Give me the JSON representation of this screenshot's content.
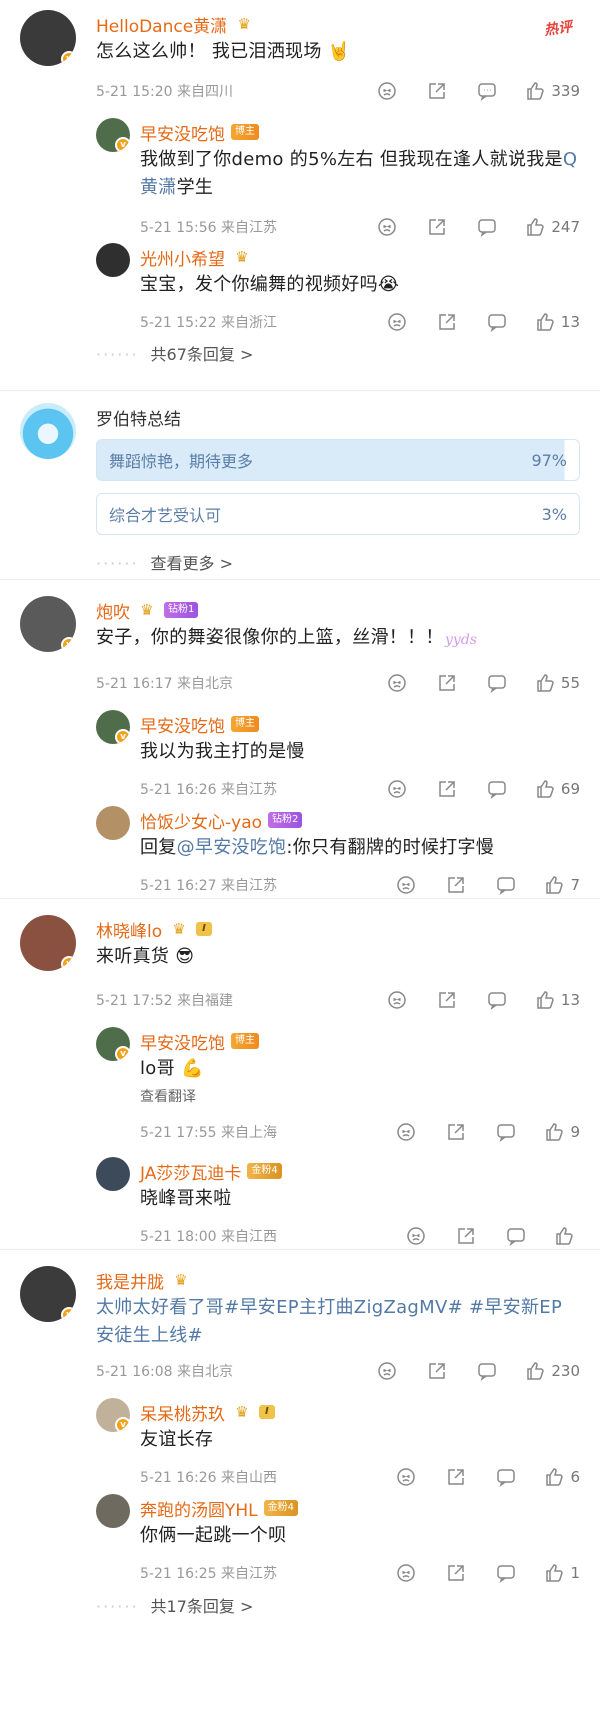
{
  "hot_label": "热评",
  "comments": [
    {
      "name": "HelloDance黄潇",
      "text": "怎么这么帅！ 我已泪洒现场",
      "emoji": "🤘",
      "time": "5-21 15:20 来自四川",
      "likes": "339",
      "replies": [
        {
          "name": "早安没吃饱",
          "badge": "博主",
          "text_pre": "我做到了你demo 的5%左右 但我现在逢人就说我是",
          "mention": "Q黄潇",
          "text_post": "学生",
          "time": "5-21 15:56 来自江苏",
          "likes": "247"
        },
        {
          "name": "光州小希望",
          "text": "宝宝，发个你编舞的视频好吗",
          "emoji": "😭",
          "time": "5-21 15:22 来自浙江",
          "likes": "13"
        }
      ],
      "more": "共67条回复 >"
    },
    {
      "name": "罗伯特总结",
      "poll": [
        {
          "label": "舞蹈惊艳，期待更多",
          "pct": "97%"
        },
        {
          "label": "综合才艺受认可",
          "pct": "3%"
        }
      ],
      "more": "查看更多 >"
    },
    {
      "name": "炮吹",
      "badge": "钻粉1",
      "text": "安子，你的舞姿很像你的上篮，丝滑！！！",
      "sticker": "yyds",
      "time": "5-21 16:17 来自北京",
      "likes": "55",
      "replies": [
        {
          "name": "早安没吃饱",
          "badge": "博主",
          "text": "我以为我主打的是慢",
          "time": "5-21 16:26 来自江苏",
          "likes": "69"
        },
        {
          "name": "恰饭少女心-yao",
          "badge": "钻粉2",
          "text_pre": "回复",
          "mention": "@早安没吃饱",
          "text_post": ":你只有翻牌的时候打字慢",
          "time": "5-21 16:27 来自江苏",
          "likes": "7"
        }
      ]
    },
    {
      "name": "林晓峰lo",
      "badge": "I",
      "text": "来听真货",
      "emoji": "😎",
      "time": "5-21 17:52 来自福建",
      "likes": "13",
      "replies": [
        {
          "name": "早安没吃饱",
          "badge": "博主",
          "text": "lo哥",
          "emoji": "💪",
          "translate": "查看翻译",
          "time": "5-21 17:55 来自上海",
          "likes": "9"
        },
        {
          "name": "JA莎莎瓦迪卡",
          "badge": "金粉4",
          "text": "晓峰哥来啦",
          "time": "5-21 18:00 来自江西",
          "likes": ""
        }
      ]
    },
    {
      "name": "我是井胧",
      "text": "太帅太好看了哥#早安EP主打曲ZigZagMV# #早安新EP安徒生上线#",
      "time": "5-21 16:08 来自北京",
      "likes": "230",
      "replies": [
        {
          "name": "呆呆桃苏玖",
          "badge": "I",
          "text": "友谊长存",
          "time": "5-21 16:26 来自山西",
          "likes": "6"
        },
        {
          "name": "奔跑的汤圆YHL",
          "badge": "金粉4",
          "text": "你俩一起跳一个呗",
          "time": "5-21 16:25 来自江苏",
          "likes": "1"
        }
      ],
      "more": "共17条回复 >"
    }
  ],
  "colors": {
    "name": "#e46a17",
    "link": "#5379a6",
    "meta": "#999999",
    "poll": "#d9ebf8"
  },
  "icons": [
    "dislike-icon",
    "share-icon",
    "comment-icon",
    "like-icon"
  ]
}
